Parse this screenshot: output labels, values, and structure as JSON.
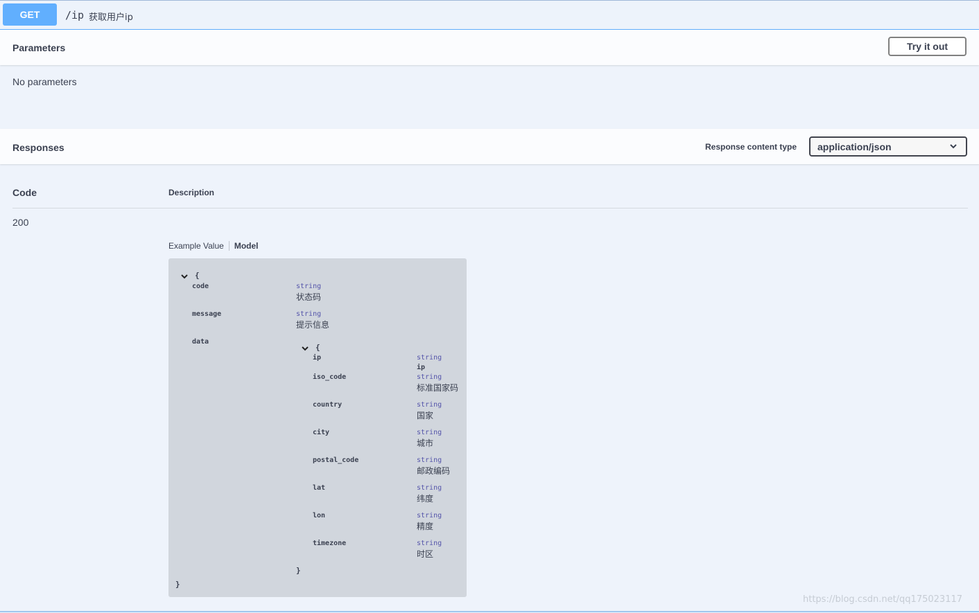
{
  "operation": {
    "method": "GET",
    "path": "/ip",
    "summary": "获取用户ip"
  },
  "parameters": {
    "title": "Parameters",
    "try_label": "Try it out",
    "empty_text": "No parameters"
  },
  "responses": {
    "title": "Responses",
    "content_type_label": "Response content type",
    "content_type_value": "application/json",
    "col_code": "Code",
    "col_description": "Description",
    "rows": [
      {
        "code": "200"
      }
    ],
    "tab_example": "Example Value",
    "tab_model": "Model"
  },
  "model": {
    "open_brace": "{",
    "close_brace": "}",
    "props": [
      {
        "name": "code",
        "type": "string",
        "desc": "状态码"
      },
      {
        "name": "message",
        "type": "string",
        "desc": "提示信息"
      },
      {
        "name": "data"
      }
    ],
    "data_open": "{",
    "data_close": "}",
    "data_props": [
      {
        "name": "ip",
        "type": "string",
        "desc": "ip"
      },
      {
        "name": "iso_code",
        "type": "string",
        "desc": "标准国家码"
      },
      {
        "name": "country",
        "type": "string",
        "desc": "国家"
      },
      {
        "name": "city",
        "type": "string",
        "desc": "城市"
      },
      {
        "name": "postal_code",
        "type": "string",
        "desc": "邮政编码"
      },
      {
        "name": "lat",
        "type": "string",
        "desc": "纬度"
      },
      {
        "name": "lon",
        "type": "string",
        "desc": "精度"
      },
      {
        "name": "timezone",
        "type": "string",
        "desc": "时区"
      }
    ]
  },
  "watermark": "https://blog.csdn.net/qq175023117",
  "colors": {
    "get_accent": "#61affe",
    "background": "#eef3fb",
    "model_bg": "#d1d6dd",
    "type_color": "#5555aa"
  },
  "icons": [
    "chevron-down-icon"
  ]
}
